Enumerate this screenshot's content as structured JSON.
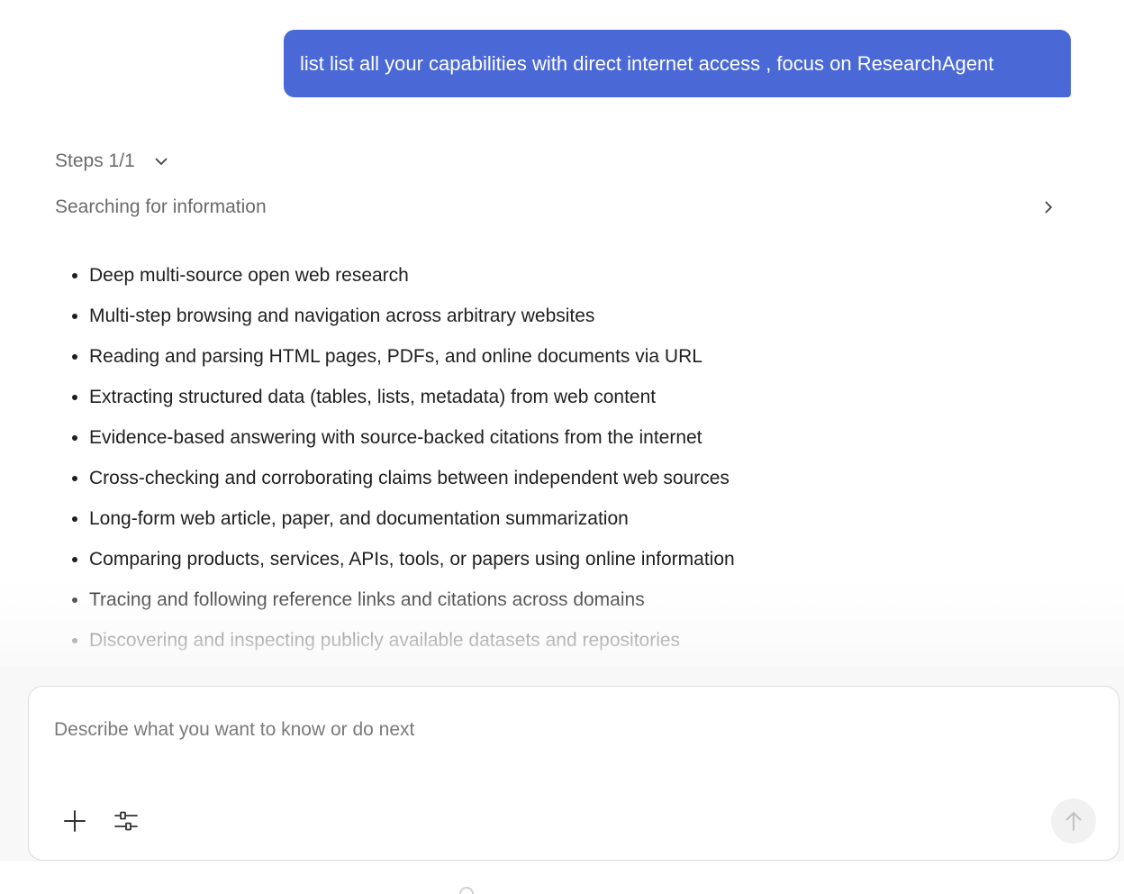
{
  "user_message": {
    "text": "list list all your capabilities with direct internet access , focus on ResearchAgent"
  },
  "steps": {
    "header_label": "Steps 1/1",
    "items": [
      {
        "label": "Searching for information"
      }
    ]
  },
  "response": {
    "capabilities": [
      "Deep multi-source open web research",
      "Multi-step browsing and navigation across arbitrary websites",
      "Reading and parsing HTML pages, PDFs, and online documents via URL",
      "Extracting structured data (tables, lists, metadata) from web content",
      "Evidence-based answering with source-backed citations from the internet",
      "Cross-checking and corroborating claims between independent web sources",
      "Long-form web article, paper, and documentation summarization",
      "Comparing products, services, APIs, tools, or papers using online information",
      "Tracing and following reference links and citations across domains",
      "Discovering and inspecting publicly available datasets and repositories"
    ]
  },
  "composer": {
    "placeholder": "Describe what you want to know or do next",
    "value": "",
    "icons": {
      "add": "plus-icon",
      "settings": "sliders-icon",
      "send": "arrow-up-icon"
    }
  },
  "colors": {
    "accent": "#4a69d6",
    "muted_text": "#6b6b6b",
    "body_text": "#1f1f1f",
    "send_button_bg": "#f1f1f1"
  }
}
